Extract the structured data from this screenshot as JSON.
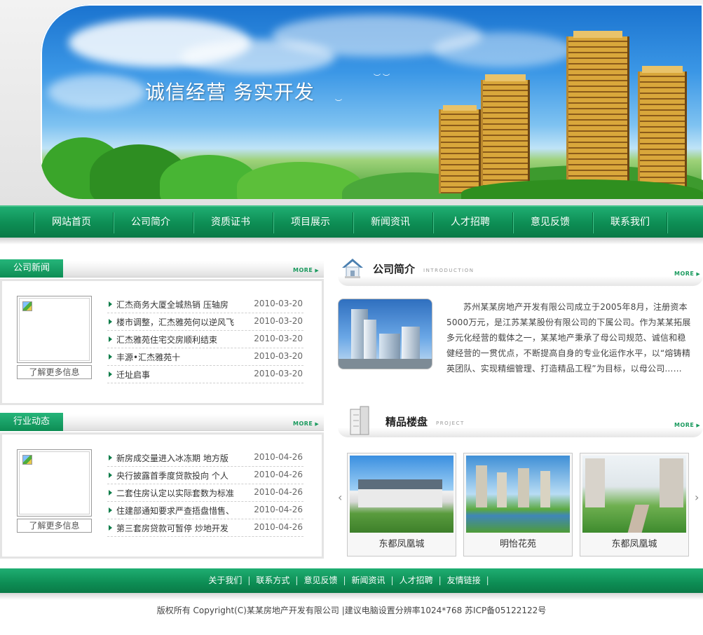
{
  "banner": {
    "slogan": "诚信经营  务实开发"
  },
  "nav": {
    "items": [
      "网站首页",
      "公司简介",
      "资质证书",
      "项目展示",
      "新闻资讯",
      "人才招聘",
      "意见反馈",
      "联系我们"
    ]
  },
  "company_news": {
    "tab": "公司新闻",
    "more": "MORE",
    "learn_more": "了解更多信息",
    "items": [
      {
        "title": "汇杰商务大厦全城热销 压轴房",
        "date": "2010-03-20"
      },
      {
        "title": "楼市调整，汇杰雅苑何以逆风飞",
        "date": "2010-03-20"
      },
      {
        "title": "汇杰雅苑住宅交房顺利结束",
        "date": "2010-03-20"
      },
      {
        "title": "丰源•汇杰雅苑十",
        "date": "2010-03-20"
      },
      {
        "title": "迁址启事",
        "date": "2010-03-20"
      }
    ]
  },
  "industry_news": {
    "tab": "行业动态",
    "more": "MORE",
    "learn_more": "了解更多信息",
    "items": [
      {
        "title": "新房成交量进入冰冻期 地方版",
        "date": "2010-04-26"
      },
      {
        "title": "央行披露首季度贷款投向 个人",
        "date": "2010-04-26"
      },
      {
        "title": "二套住房认定以实际套数为标准",
        "date": "2010-04-26"
      },
      {
        "title": "住建部通知要求严查捂盘惜售、",
        "date": "2010-04-26"
      },
      {
        "title": "第三套房贷款可暂停 炒地开发",
        "date": "2010-04-26"
      }
    ]
  },
  "intro": {
    "title": "公司简介",
    "subtitle": "INTRODUCTION",
    "more": "MORE",
    "text": "苏州某某房地产开发有限公司成立于2005年8月，注册资本5000万元，是江苏某某股份有限公司的下属公司。作为某某拓展多元化经营的载体之一，某某地产秉承了母公司规范、诚信和稳健经营的一贯优点，不断提高自身的专业化运作水平，以“熔铸精英团队、实现精细管理、打造精品工程”为目标，以母公司……"
  },
  "projects": {
    "title": "精品楼盘",
    "subtitle": "PROJECT",
    "more": "MORE",
    "prev_icon": "‹",
    "next_icon": "›",
    "items": [
      {
        "name": "东都凤凰城"
      },
      {
        "name": "明怡花苑"
      },
      {
        "name": "东都凤凰城"
      }
    ]
  },
  "footer": {
    "links": [
      "关于我们",
      "联系方式",
      "意见反馈",
      "新闻资讯",
      "人才招聘",
      "友情链接"
    ],
    "separator": "|",
    "copyright": "版权所有  Copyright(C)某某房地产开发有限公司  |建议电脑设置分辨率1024*768 苏ICP备05122122号"
  },
  "colors": {
    "primary_green": "#0d8d54",
    "accent_green": "#1fae72"
  }
}
